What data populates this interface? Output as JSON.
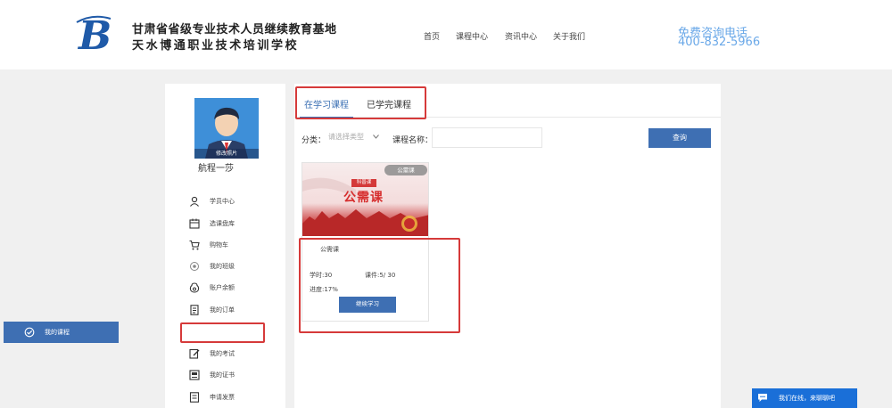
{
  "header": {
    "org_line1": "甘肃省省级专业技术人员继续教育基地",
    "org_line2": "天水博通职业技术培训学校",
    "nav": [
      "首页",
      "课程中心",
      "资讯中心",
      "关于我们"
    ],
    "phone_title": "免费咨询电话",
    "phone_number": "400-832-5966"
  },
  "sidebar": {
    "avatar_band": "修改照片",
    "username": "航程一莎",
    "items": [
      {
        "label": "学员中心",
        "icon": "user-icon"
      },
      {
        "label": "选课盘库",
        "icon": "calendar-icon"
      },
      {
        "label": "购物车",
        "icon": "cart-icon"
      },
      {
        "label": "我的班级",
        "icon": "class-icon"
      },
      {
        "label": "账户余额",
        "icon": "wallet-icon"
      },
      {
        "label": "我的订单",
        "icon": "order-icon"
      },
      {
        "label": "我的课程",
        "icon": "course-icon",
        "active": true
      },
      {
        "label": "我的考试",
        "icon": "exam-icon"
      },
      {
        "label": "我的证书",
        "icon": "certificate-icon"
      },
      {
        "label": "申请发票",
        "icon": "invoice-icon"
      }
    ]
  },
  "main": {
    "tabs": [
      "在学习课程",
      "已学完课程"
    ],
    "filter": {
      "category_label": "分类：",
      "category_placeholder": "请选择类型",
      "name_label": "课程名称：",
      "name_value": "",
      "query_button": "查询"
    },
    "course": {
      "badge": "公需课",
      "ribbon": "科普课",
      "headline": "公需课",
      "title": "公需课",
      "hours": "学时:30",
      "lessons": "课件:5/ 30",
      "progress": "进度:17%",
      "progress_value": 0.17,
      "continue_button": "继续学习"
    }
  },
  "chat": {
    "label": "我们在线，来聊聊吧"
  },
  "colors": {
    "primary": "#3e6fb3",
    "highlight": "#d63a3a",
    "phone": "#6aa8e8",
    "chat": "#1a6fd8"
  }
}
